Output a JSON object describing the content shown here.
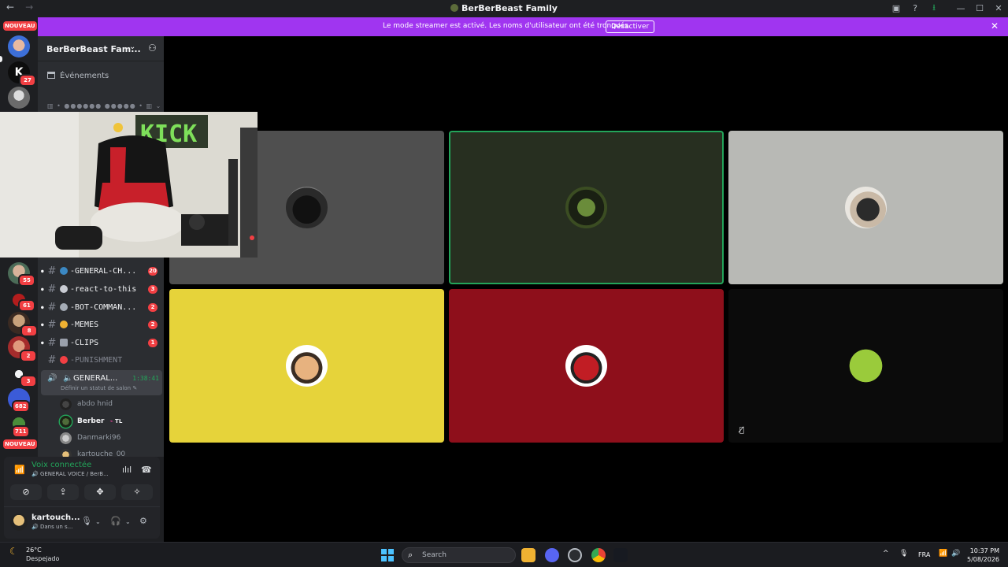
{
  "window": {
    "title": "BerBerBeast Family",
    "back_icon": "arrow-left-icon",
    "forward_icon": "arrow-right-icon"
  },
  "banner": {
    "message": "Le mode streamer est activé. Les noms d'utilisateur ont été tronqués.",
    "action_label": "Désactiver",
    "color": "#a035f0"
  },
  "server_rail": {
    "new_label_top": "NOUVEAU",
    "new_label_bottom": "NOUVEAU",
    "badges": [
      "27",
      "55",
      "61",
      "8",
      "2",
      "3",
      "682",
      "711"
    ]
  },
  "sidebar": {
    "server_name": "BerBerBeast Fam...",
    "events_label": "Événements",
    "truncated_category": "▥ • ●●●●●● ●●●●● • ▥ ⌄",
    "channels": [
      {
        "name": "-GENERAL-CH...",
        "count": "20"
      },
      {
        "name": "-react-to-this",
        "count": "3"
      },
      {
        "name": "-BOT-COMMAN...",
        "count": "2"
      },
      {
        "name": "-MEMES",
        "count": "2"
      },
      {
        "name": "-CLIPS",
        "count": "1"
      },
      {
        "name": "-PUNISHMENT",
        "count": ""
      }
    ],
    "voice_channel": {
      "name": "GENERAL...",
      "timer": "1:38:41",
      "status": "Définir un statut de salon"
    },
    "voice_users": [
      {
        "name": "abdo hnid"
      },
      {
        "name": "Berber",
        "tag": "TL"
      },
      {
        "name": "Danmarki96"
      },
      {
        "name": "kartouche_00"
      }
    ]
  },
  "voice_panel": {
    "status": "Voix connectée",
    "location": "GENERAL VOICE / BerB...",
    "user_name": "kartouch...",
    "user_status": "Dans un s..."
  },
  "taskbar": {
    "temperature": "26°C",
    "condition": "Despejado",
    "search_placeholder": "Search",
    "language": "FRA",
    "time": "10:37 PM",
    "date": "5/08/2026"
  },
  "colors": {
    "speaking": "#23a55a",
    "badge": "#f23f43",
    "tiles": [
      "#4f4f4f",
      "#272f20",
      "#b8b9b5",
      "#e6d33a",
      "#8e0f1b",
      "#0b0b0b"
    ]
  }
}
